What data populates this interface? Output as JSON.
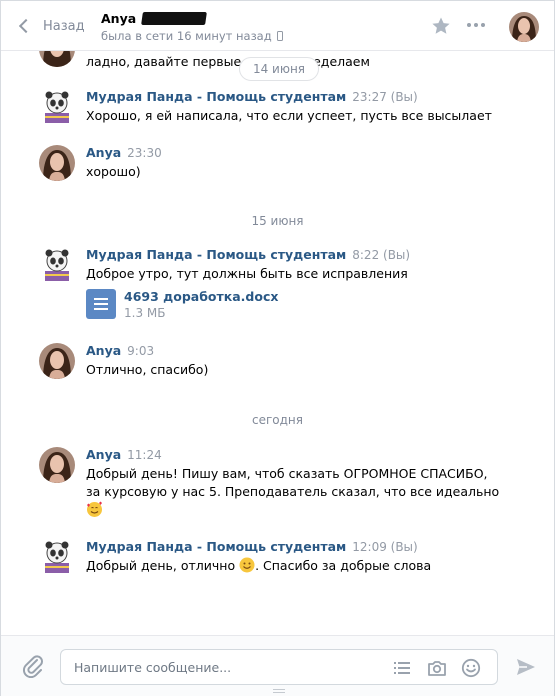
{
  "header": {
    "back_label": "Назад",
    "peer_name": "Anya",
    "peer_status": "была в сети 16 минут назад"
  },
  "pinned_date": "14 июня",
  "partial_message_text": "ладно, давайте первые д... ия переделаем",
  "dates": {
    "june15": "15 июня",
    "today": "сегодня"
  },
  "messages": [
    {
      "author": "Мудрая Панда - Помощь студентам",
      "time": "23:27 (Вы)",
      "text": "Хорошо, я ей написала, что если успеет, пусть все высылает"
    },
    {
      "author": "Anya",
      "time": "23:30",
      "text": "хорошо)"
    },
    {
      "author": "Мудрая Панда - Помощь студентам",
      "time": "8:22 (Вы)",
      "text": "Доброе утро, тут должны быть все исправления",
      "file": {
        "name": "4693 доработка.docx",
        "size": "1.3 МБ"
      }
    },
    {
      "author": "Anya",
      "time": "9:03",
      "text": "Отлично, спасибо)"
    },
    {
      "author": "Anya",
      "time": "11:24",
      "text_line1": "Добрый день! Пишу вам, чтоб сказать ОГРОМНОЕ СПАСИБО,",
      "text_line2": "за курсовую у нас 5. Преподаватель сказал, что все идеально"
    },
    {
      "author": "Мудрая Панда - Помощь студентам",
      "time": "12:09 (Вы)",
      "text_before": "Добрый день, отлично ",
      "text_after": ". Спасибо за добрые слова"
    }
  ],
  "composer": {
    "placeholder": "Напишите сообщение..."
  },
  "icons": {
    "back": "chevron-left-icon",
    "star": "star-icon",
    "more": "more-dots-icon",
    "attach": "paperclip-icon",
    "template": "list-icon",
    "camera": "camera-icon",
    "smile": "smile-icon",
    "send": "send-icon",
    "file": "document-icon",
    "emoji_love": "smiling-face-with-hearts-icon",
    "emoji_smile": "smiling-face-icon"
  },
  "colors": {
    "link": "#2a5885",
    "muted": "#828a99",
    "file_icon": "#5b88c4"
  }
}
